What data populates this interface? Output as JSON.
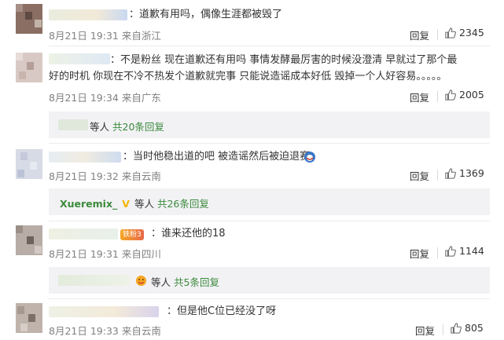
{
  "comments": [
    {
      "text": "：道歉有用吗，偶像生涯都被毁了",
      "time": "8月21日 19:31",
      "location": "来自浙江",
      "reply_label": "回复",
      "likes": "2345"
    },
    {
      "text": "：不是粉丝 现在道歉还有用吗 事情发酵最厉害的时候没澄清 早就过了那个最好的时机 你现在不冷不热发个道歉就完事 只能说造谣成本好低 毁掉一个人好容易。。。。。",
      "time": "8月21日 19:34",
      "location": "来自广东",
      "reply_label": "回复",
      "likes": "2005",
      "sub": {
        "prefix": "等人",
        "count": "共20条回复"
      }
    },
    {
      "text": "：当时他稳出道的吧 被造谣然后被迫退赛",
      "time": "8月21日 19:32",
      "location": "来自云南",
      "reply_label": "回复",
      "likes": "1369",
      "sub": {
        "name": "Xueremix_",
        "vip": "V",
        "prefix": "等人",
        "count": "共26条回复"
      }
    },
    {
      "text": "：谁来还他的18",
      "time": "8月21日 19:31",
      "location": "来自四川",
      "reply_label": "回复",
      "likes": "1144",
      "badge": "铁粉3",
      "sub": {
        "prefix": "等人",
        "count": "共5条回复"
      }
    },
    {
      "text": "：但是他C位已经没了呀",
      "time": "8月21日 19:33",
      "location": "来自云南",
      "reply_label": "回复",
      "likes": "805"
    }
  ],
  "colors": {
    "accent_green": "#3c8a3c",
    "vip_gold": "#f5b400",
    "meta_gray": "#808080"
  },
  "icons": [
    "thumb-up-icon",
    "vip-icon",
    "fan-badge-icon",
    "emoji-icon"
  ]
}
